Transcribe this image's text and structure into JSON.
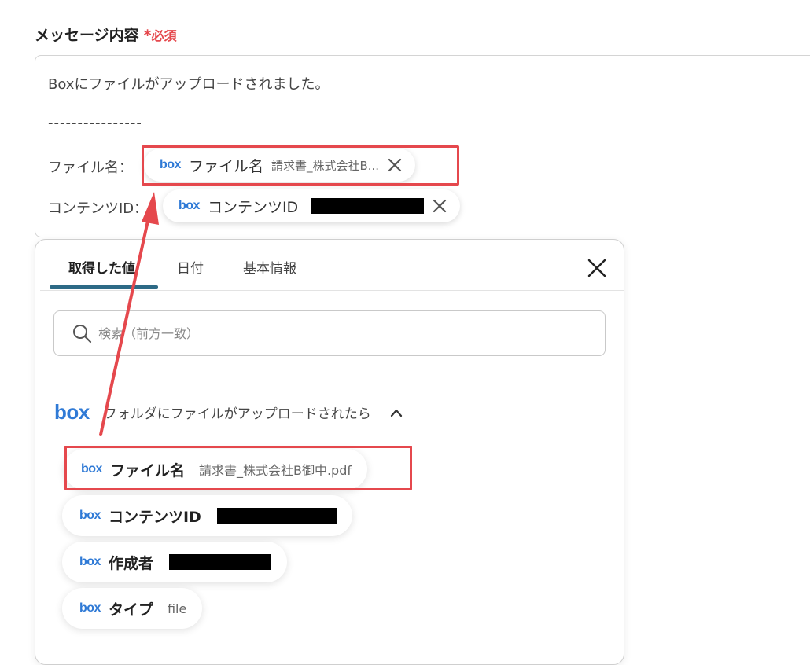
{
  "field": {
    "label": "メッセージ内容",
    "required_star": "*",
    "required_text": "必須"
  },
  "message": {
    "line1": "Boxにファイルがアップロードされました。",
    "separator": "----------------",
    "filename_label": "ファイル名：",
    "contentid_label": "コンテンツID：",
    "chips": [
      {
        "logo": "box",
        "name": "ファイル名",
        "value": "請求書_株式会社B..."
      },
      {
        "logo": "box",
        "name": "コンテンツID",
        "value": ""
      }
    ]
  },
  "panel": {
    "tabs": [
      {
        "label": "取得した値"
      },
      {
        "label": "日付"
      },
      {
        "label": "基本情報"
      }
    ],
    "search_placeholder": "検索（前方一致）",
    "group": {
      "logo": "box",
      "title": "フォルダにファイルがアップロードされたら"
    },
    "options": [
      {
        "logo": "box",
        "name": "ファイル名",
        "value": "請求書_株式会社B御中.pdf"
      },
      {
        "logo": "box",
        "name": "コンテンツID",
        "value": ""
      },
      {
        "logo": "box",
        "name": "作成者",
        "value": ""
      },
      {
        "logo": "box",
        "name": "タイプ",
        "value": "file"
      }
    ]
  },
  "colors": {
    "brand_box": "#2f7ad6",
    "highlight": "#e5484d",
    "required": "#e5484d",
    "tab_active": "#2d6a86"
  },
  "icons": [
    "close-icon",
    "search-icon",
    "chevron-up-icon"
  ]
}
